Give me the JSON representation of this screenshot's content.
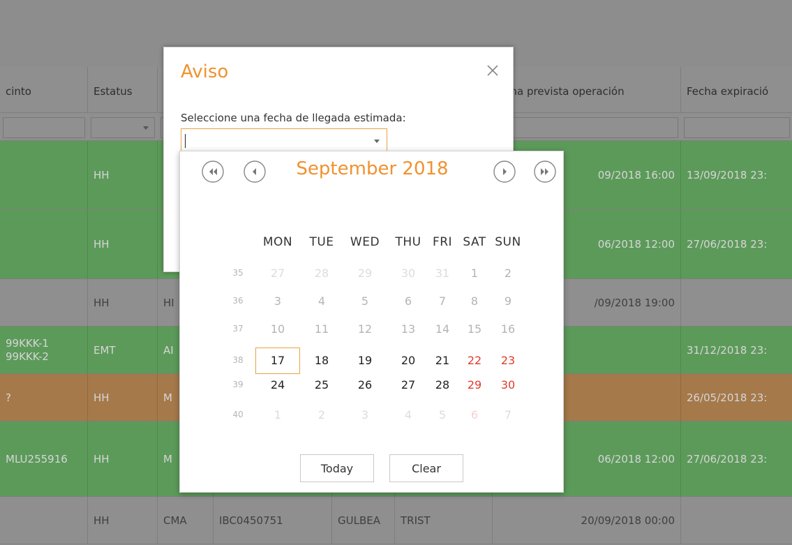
{
  "grid": {
    "columns": [
      {
        "key": "precinto",
        "label": "cinto"
      },
      {
        "key": "estatus",
        "label": "Estatus"
      },
      {
        "key": "c3",
        "label": ""
      },
      {
        "key": "c4",
        "label": ""
      },
      {
        "key": "c5",
        "label": ""
      },
      {
        "key": "c6",
        "label": ""
      },
      {
        "key": "fecha_prevista",
        "label": "echa prevista operación"
      },
      {
        "key": "fecha_expiracion",
        "label": "Fecha expiració"
      }
    ],
    "rows": [
      {
        "color": "#5c9a5a",
        "dark": false,
        "cells": [
          "",
          "HH",
          "",
          "",
          "",
          "",
          "09/2018 16:00",
          "13/09/2018 23:"
        ]
      },
      {
        "color": "#5c9a5a",
        "dark": false,
        "cells": [
          "",
          "HH",
          "",
          "",
          "",
          "",
          "06/2018 12:00",
          "27/06/2018 23:"
        ]
      },
      {
        "color": "#8f8f8f",
        "dark": true,
        "cells": [
          "",
          "HH",
          "HI",
          "",
          "",
          "",
          "/09/2018 19:00",
          ""
        ]
      },
      {
        "color": "#5c9a5a",
        "dark": false,
        "cells": [
          "99KKK-1|99KKK-2",
          "EMT",
          "AI",
          "",
          "",
          "",
          "",
          "31/12/2018 23:"
        ]
      },
      {
        "color": "#a5794a",
        "dark": false,
        "cells": [
          "?",
          "HH",
          "M",
          "",
          "",
          "",
          "",
          "26/05/2018 23:"
        ]
      },
      {
        "color": "#5c9a5a",
        "dark": false,
        "cells": [
          "MLU255916",
          "HH",
          "M",
          "",
          "",
          "",
          "06/2018 12:00",
          "27/06/2018 23:"
        ]
      },
      {
        "color": "#8f8f8f",
        "dark": true,
        "cells": [
          "",
          "HH",
          "CMA",
          "IBC0450751",
          "GULBEA",
          "TRIST",
          "20/09/2018 00:00",
          ""
        ]
      }
    ]
  },
  "dialog": {
    "title": "Aviso",
    "prompt": "Seleccione una fecha de llegada estimada:",
    "input_value": "",
    "accent_color": "#f0922e"
  },
  "calendar": {
    "month_label": "September 2018",
    "weekdays": [
      "MON",
      "TUE",
      "WED",
      "THU",
      "FRI",
      "SAT",
      "SUN"
    ],
    "weeks": [
      {
        "num": "35",
        "days": [
          "27",
          "28",
          "29",
          "30",
          "31",
          "1",
          "2"
        ],
        "state": [
          "faint",
          "faint",
          "faint",
          "faint",
          "faint",
          "muted",
          "muted"
        ]
      },
      {
        "num": "36",
        "days": [
          "3",
          "4",
          "5",
          "6",
          "7",
          "8",
          "9"
        ],
        "state": [
          "muted",
          "muted",
          "muted",
          "muted",
          "muted",
          "muted",
          "muted"
        ]
      },
      {
        "num": "37",
        "days": [
          "10",
          "11",
          "12",
          "13",
          "14",
          "15",
          "16"
        ],
        "state": [
          "muted",
          "muted",
          "muted",
          "muted",
          "muted",
          "muted",
          "muted"
        ]
      },
      {
        "num": "38",
        "days": [
          "17",
          "18",
          "19",
          "20",
          "21",
          "22",
          "23"
        ],
        "state": [
          "sel",
          "norm",
          "norm",
          "norm",
          "norm",
          "wend",
          "wend"
        ]
      },
      {
        "num": "39",
        "days": [
          "24",
          "25",
          "26",
          "27",
          "28",
          "29",
          "30"
        ],
        "state": [
          "norm",
          "norm",
          "norm",
          "norm",
          "norm",
          "wend",
          "wend"
        ]
      },
      {
        "num": "40",
        "days": [
          "1",
          "2",
          "3",
          "4",
          "5",
          "6",
          "7"
        ],
        "state": [
          "faint",
          "faint",
          "faint",
          "faint",
          "faint",
          "faintw",
          "faint"
        ]
      }
    ],
    "selected_day": "17",
    "today_label": "Today",
    "clear_label": "Clear",
    "weekend_color": "#e13b2b"
  }
}
